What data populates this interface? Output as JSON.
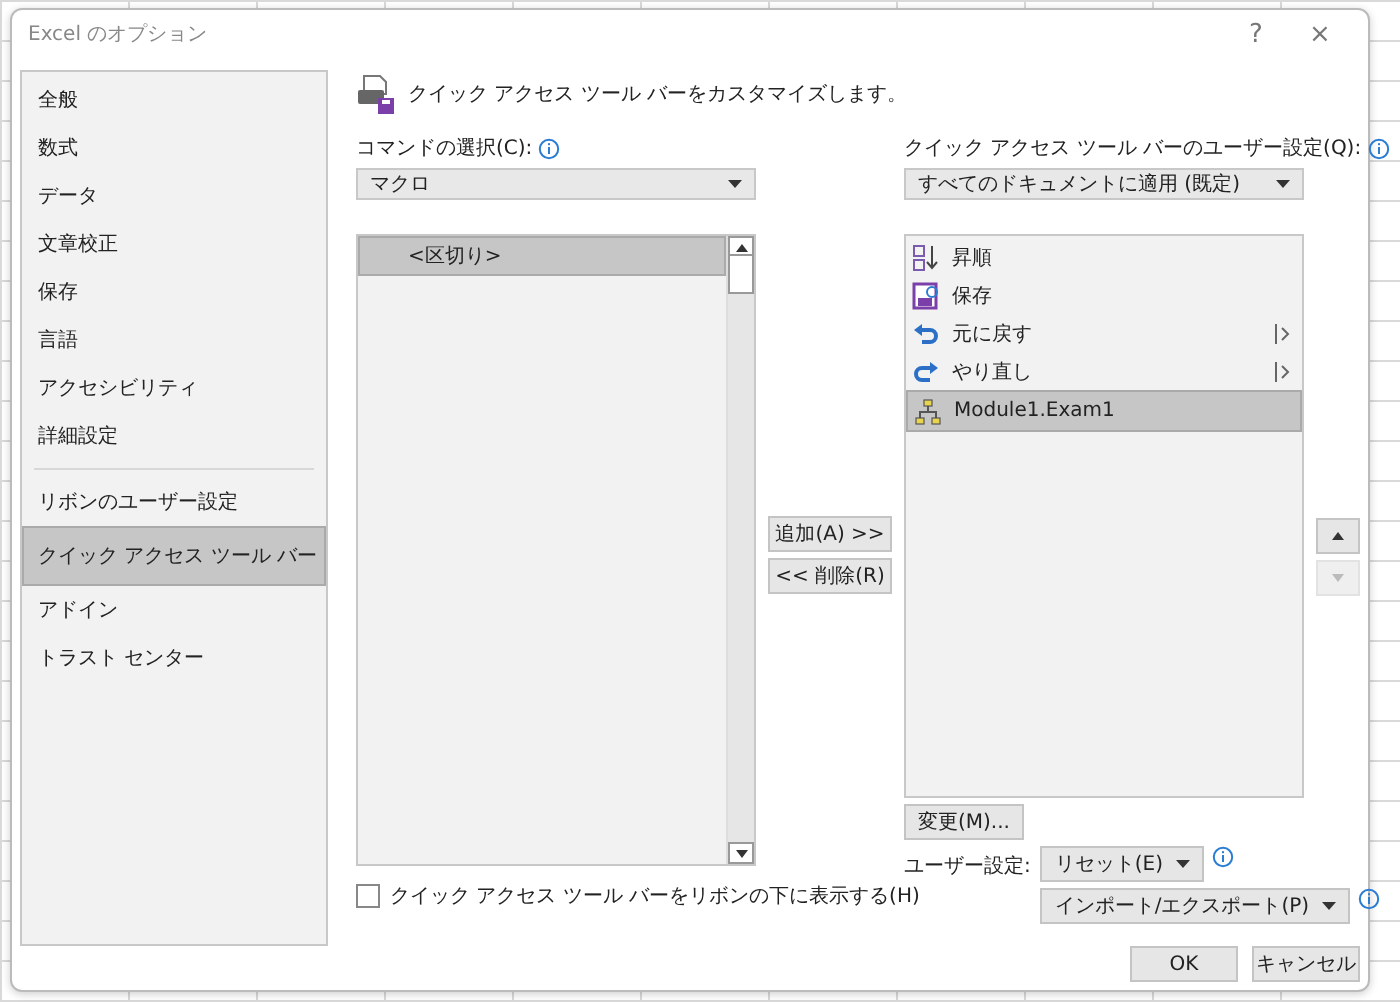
{
  "window": {
    "title": "Excel のオプション",
    "help_button": "?",
    "close_button": "×"
  },
  "sidebar": {
    "sections": [
      {
        "items": [
          {
            "label": "全般",
            "selected": false
          },
          {
            "label": "数式",
            "selected": false
          },
          {
            "label": "データ",
            "selected": false
          },
          {
            "label": "文章校正",
            "selected": false
          },
          {
            "label": "保存",
            "selected": false
          },
          {
            "label": "言語",
            "selected": false
          },
          {
            "label": "アクセシビリティ",
            "selected": false
          },
          {
            "label": "詳細設定",
            "selected": false
          }
        ]
      },
      {
        "items": [
          {
            "label": "リボンのユーザー設定",
            "selected": false
          },
          {
            "label": "クイック アクセス ツール バー",
            "selected": true
          },
          {
            "label": "アドイン",
            "selected": false
          },
          {
            "label": "トラスト センター",
            "selected": false
          }
        ]
      }
    ]
  },
  "header": {
    "text": "クイック アクセス ツール バーをカスタマイズします。"
  },
  "commands": {
    "label": "コマンドの選択(C):",
    "dropdown": "マクロ",
    "items": [
      {
        "label": "<区切り>",
        "selected": true
      }
    ]
  },
  "show_below_ribbon": {
    "label": "クイック アクセス ツール バーをリボンの下に表示する(H)",
    "checked": false
  },
  "add_button": "追加(A) >>",
  "remove_button": "<< 削除(R)",
  "toolbar": {
    "label": "クイック アクセス ツール バーのユーザー設定(Q):",
    "dropdown": "すべてのドキュメントに適用 (既定)",
    "items": [
      {
        "kind": "sort",
        "label": "昇順",
        "submenu": false,
        "selected": false
      },
      {
        "kind": "save",
        "label": "保存",
        "submenu": false,
        "selected": false
      },
      {
        "kind": "undo",
        "label": "元に戻す",
        "submenu": true,
        "selected": false
      },
      {
        "kind": "redo",
        "label": "やり直し",
        "submenu": true,
        "selected": false
      },
      {
        "kind": "macro",
        "label": "Module1.Exam1",
        "submenu": false,
        "selected": true
      }
    ]
  },
  "move_up": {
    "disabled": false
  },
  "move_down": {
    "disabled": true
  },
  "modify_button": "変更(M)...",
  "customizations": {
    "label": "ユーザー設定:",
    "reset_button": "リセット(E)",
    "import_export_button": "インポート/エクスポート(P)"
  },
  "buttons": [
    "OK",
    "キャンセル"
  ]
}
